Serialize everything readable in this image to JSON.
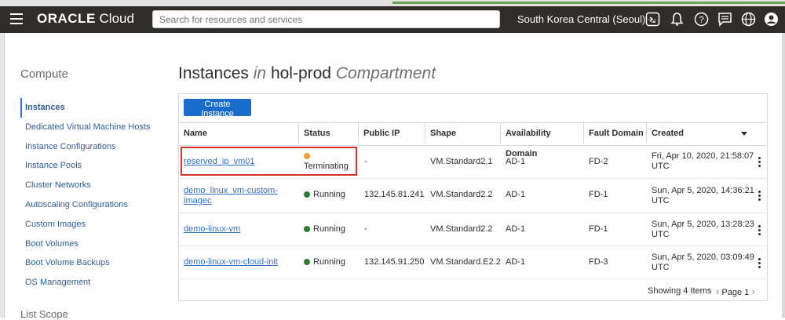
{
  "header": {
    "logo_brand": "ORACLE",
    "logo_product": "Cloud",
    "search_placeholder": "Search for resources and services",
    "region": "South Korea Central (Seoul)"
  },
  "sidebar": {
    "title": "Compute",
    "items": [
      {
        "label": "Instances"
      },
      {
        "label": "Dedicated Virtual Machine Hosts"
      },
      {
        "label": "Instance Configurations"
      },
      {
        "label": "Instance Pools"
      },
      {
        "label": "Cluster Networks"
      },
      {
        "label": "Autoscaling Configurations"
      },
      {
        "label": "Custom Images"
      },
      {
        "label": "Boot Volumes"
      },
      {
        "label": "Boot Volume Backups"
      },
      {
        "label": "OS Management"
      }
    ],
    "list_scope": "List Scope"
  },
  "main": {
    "title_prefix": "Instances",
    "title_in": "in",
    "compartment": "hol-prod",
    "title_suffix": "Compartment",
    "create_button": "Create Instance",
    "columns": [
      "Name",
      "Status",
      "Public IP",
      "Shape",
      "Availability Domain",
      "Fault Domain",
      "Created"
    ],
    "rows": [
      {
        "name": "reserved_ip_vm01",
        "name_line2": "",
        "status": "Terminating",
        "public_ip": "-",
        "shape": "VM.Standard2.1",
        "ad": "AD-1",
        "fd": "FD-2",
        "created": "Fri, Apr 10, 2020, 21:58:07",
        "created_tz": "UTC"
      },
      {
        "name": "demo_linux_vm-custom-",
        "name_line2": "imagec",
        "status": "Running",
        "public_ip": "132.145.81.241",
        "shape": "VM.Standard2.2",
        "ad": "AD-1",
        "fd": "FD-1",
        "created": "Sun, Apr 5, 2020, 14:36:21",
        "created_tz": "UTC"
      },
      {
        "name": "demo-linux-vm",
        "name_line2": "",
        "status": "Running",
        "public_ip": "-",
        "shape": "VM.Standard2.2",
        "ad": "AD-1",
        "fd": "FD-1",
        "created": "Sun, Apr 5, 2020, 13:28:23",
        "created_tz": "UTC"
      },
      {
        "name": "demo-linux-vm-cloud-init",
        "name_line2": "",
        "status": "Running",
        "public_ip": "132.145.91.250",
        "shape": "VM.Standard.E2.2",
        "ad": "AD-1",
        "fd": "FD-3",
        "created": "Sun, Apr 5, 2020, 03:09:49",
        "created_tz": "UTC"
      }
    ],
    "showing": "Showing 4 Items",
    "page_label": "Page 1"
  },
  "colors": {
    "navbar": "#312d2a",
    "primary_button": "#1a6ccc",
    "link": "#2f6fc6",
    "status_running": "#2e7d32",
    "status_terminating": "#f0a030",
    "highlight_box": "#d9322b"
  },
  "icons": [
    "hamburger-icon",
    "cloud-shell-icon",
    "bell-icon",
    "help-icon",
    "chat-icon",
    "globe-icon",
    "profile-icon",
    "chevron-down-icon",
    "kebab-icon",
    "chevron-left-icon",
    "chevron-right-icon"
  ]
}
